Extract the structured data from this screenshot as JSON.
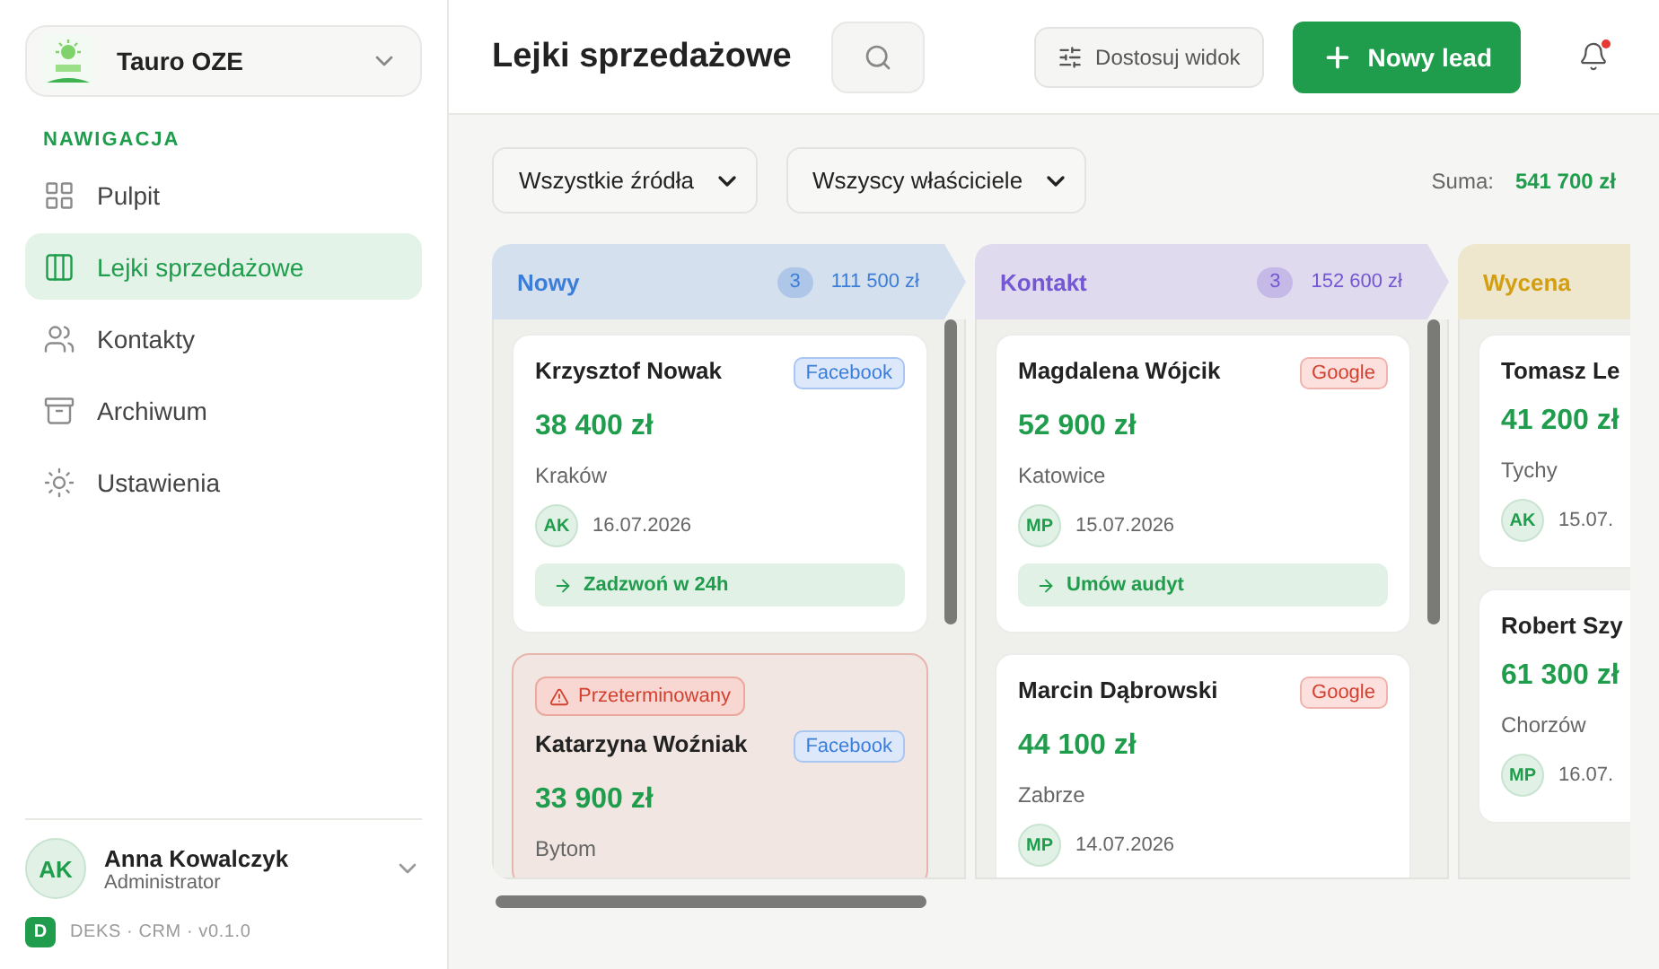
{
  "sidebar": {
    "brand": {
      "name": "Tauro OZE"
    },
    "section_label": "NAWIGACJA",
    "items": [
      {
        "label": "Pulpit",
        "selected": false
      },
      {
        "label": "Lejki sprzedażowe",
        "selected": true
      },
      {
        "label": "Kontakty",
        "selected": false
      },
      {
        "label": "Archiwum",
        "selected": false
      },
      {
        "label": "Ustawienia",
        "selected": false
      }
    ],
    "user": {
      "initials": "AK",
      "name": "Anna Kowalczyk",
      "role": "Administrator"
    },
    "version": {
      "badge": "D",
      "label": "DEKS · CRM · v0.1.0"
    }
  },
  "header": {
    "title": "Lejki sprzedażowe",
    "customize_button": "Dostosuj widok",
    "new_button": "Nowy lead",
    "has_notification": true
  },
  "filters": {
    "source": "Wszystkie źródła",
    "owner": "Wszyscy właściciele",
    "sum_label": "Suma:",
    "sum_value": "541 700 zł"
  },
  "columns": [
    {
      "title": "Nowy",
      "color": "#3b7dd8",
      "count": "3",
      "total": "111 500 zł",
      "cards": [
        {
          "name": "Krzysztof Nowak",
          "source": {
            "label": "Facebook",
            "kind": "facebook"
          },
          "amount": "38 400 zł",
          "city": "Kraków",
          "owner": "AK",
          "date": "16.07.2026",
          "action": "Zadzwoń w 24h",
          "overdue": false
        },
        {
          "alert": "Przeterminowany",
          "name": "Katarzyna Woźniak",
          "source": {
            "label": "Facebook",
            "kind": "facebook"
          },
          "amount": "33 900 zł",
          "city": "Bytom",
          "overdue": true
        }
      ]
    },
    {
      "title": "Kontakt",
      "color": "#7457d2",
      "count": "3",
      "total": "152 600 zł",
      "cards": [
        {
          "name": "Magdalena Wójcik",
          "source": {
            "label": "Google",
            "kind": "google"
          },
          "amount": "52 900 zł",
          "city": "Katowice",
          "owner": "MP",
          "date": "15.07.2026",
          "action": "Umów audyt",
          "overdue": false
        },
        {
          "name": "Marcin Dąbrowski",
          "source": {
            "label": "Google",
            "kind": "google"
          },
          "amount": "44 100 zł",
          "city": "Zabrze",
          "owner": "MP",
          "date": "14.07.2026",
          "overdue": false
        }
      ]
    },
    {
      "title": "Wycena",
      "color": "#d39f12",
      "cards": [
        {
          "name": "Tomasz Le",
          "amount": "41 200 zł",
          "city": "Tychy",
          "owner": "AK",
          "date": "15.07.",
          "overdue": false
        },
        {
          "name": "Robert Szy",
          "amount": "61 300 zł",
          "city": "Chorzów",
          "owner": "MP",
          "date": "16.07.",
          "overdue": false
        }
      ]
    }
  ]
}
